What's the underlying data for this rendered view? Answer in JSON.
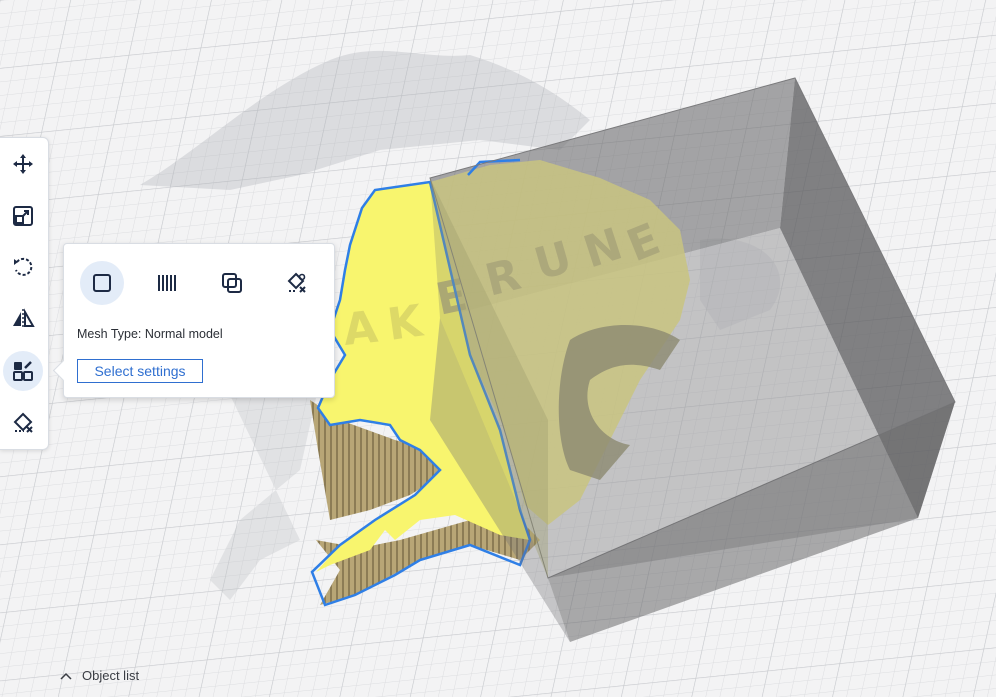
{
  "colors": {
    "accent": "#2f6fd0",
    "active_bg": "#e3ecf8",
    "model_yellow": "#f8f56e",
    "annotation_arrow": "#e2502a"
  },
  "toolbar": {
    "tools": [
      {
        "icon": "move-icon"
      },
      {
        "icon": "scale-icon"
      },
      {
        "icon": "rotate-icon"
      },
      {
        "icon": "mirror-icon"
      },
      {
        "icon": "mesh-settings-icon",
        "active": true
      },
      {
        "icon": "support-paint-icon"
      }
    ]
  },
  "mesh_popup": {
    "buttons": [
      {
        "icon": "normal-model-icon",
        "active": true
      },
      {
        "icon": "infill-mesh-icon"
      },
      {
        "icon": "cutting-mesh-icon"
      },
      {
        "icon": "support-blocker-icon"
      }
    ],
    "mesh_type_label": "Mesh Type: Normal model",
    "select_settings_label": "Select settings"
  },
  "object_list": {
    "label": "Object list",
    "icon": "chevron-up-icon"
  }
}
